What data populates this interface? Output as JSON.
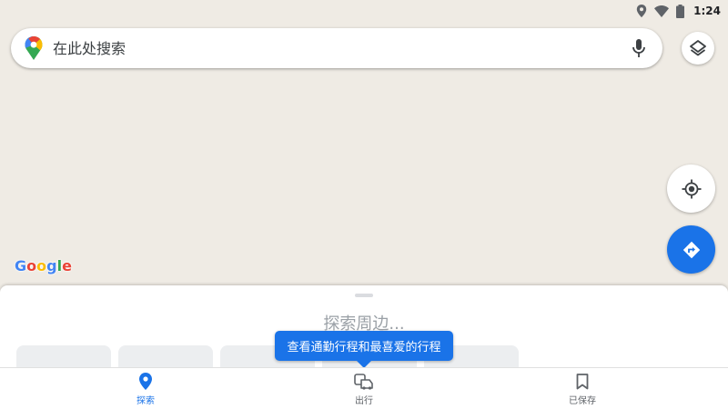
{
  "status_bar": {
    "time": "1:24",
    "icons": [
      "location-icon",
      "wifi-icon",
      "battery-icon"
    ]
  },
  "search": {
    "placeholder": "在此处搜索",
    "value": ""
  },
  "map": {
    "attribution": [
      "G",
      "o",
      "o",
      "g",
      "l",
      "e"
    ]
  },
  "sheet": {
    "title": "探索周边..."
  },
  "tooltip": {
    "text": "查看通勤行程和最喜爱的行程"
  },
  "nav": {
    "items": [
      {
        "label": "探索",
        "icon": "explore-pin-icon",
        "active": true
      },
      {
        "label": "出行",
        "icon": "commute-icon",
        "active": false
      },
      {
        "label": "已保存",
        "icon": "bookmark-icon",
        "active": false
      }
    ]
  },
  "colors": {
    "accent": "#1a73e8",
    "map_background": "#efebe4"
  }
}
